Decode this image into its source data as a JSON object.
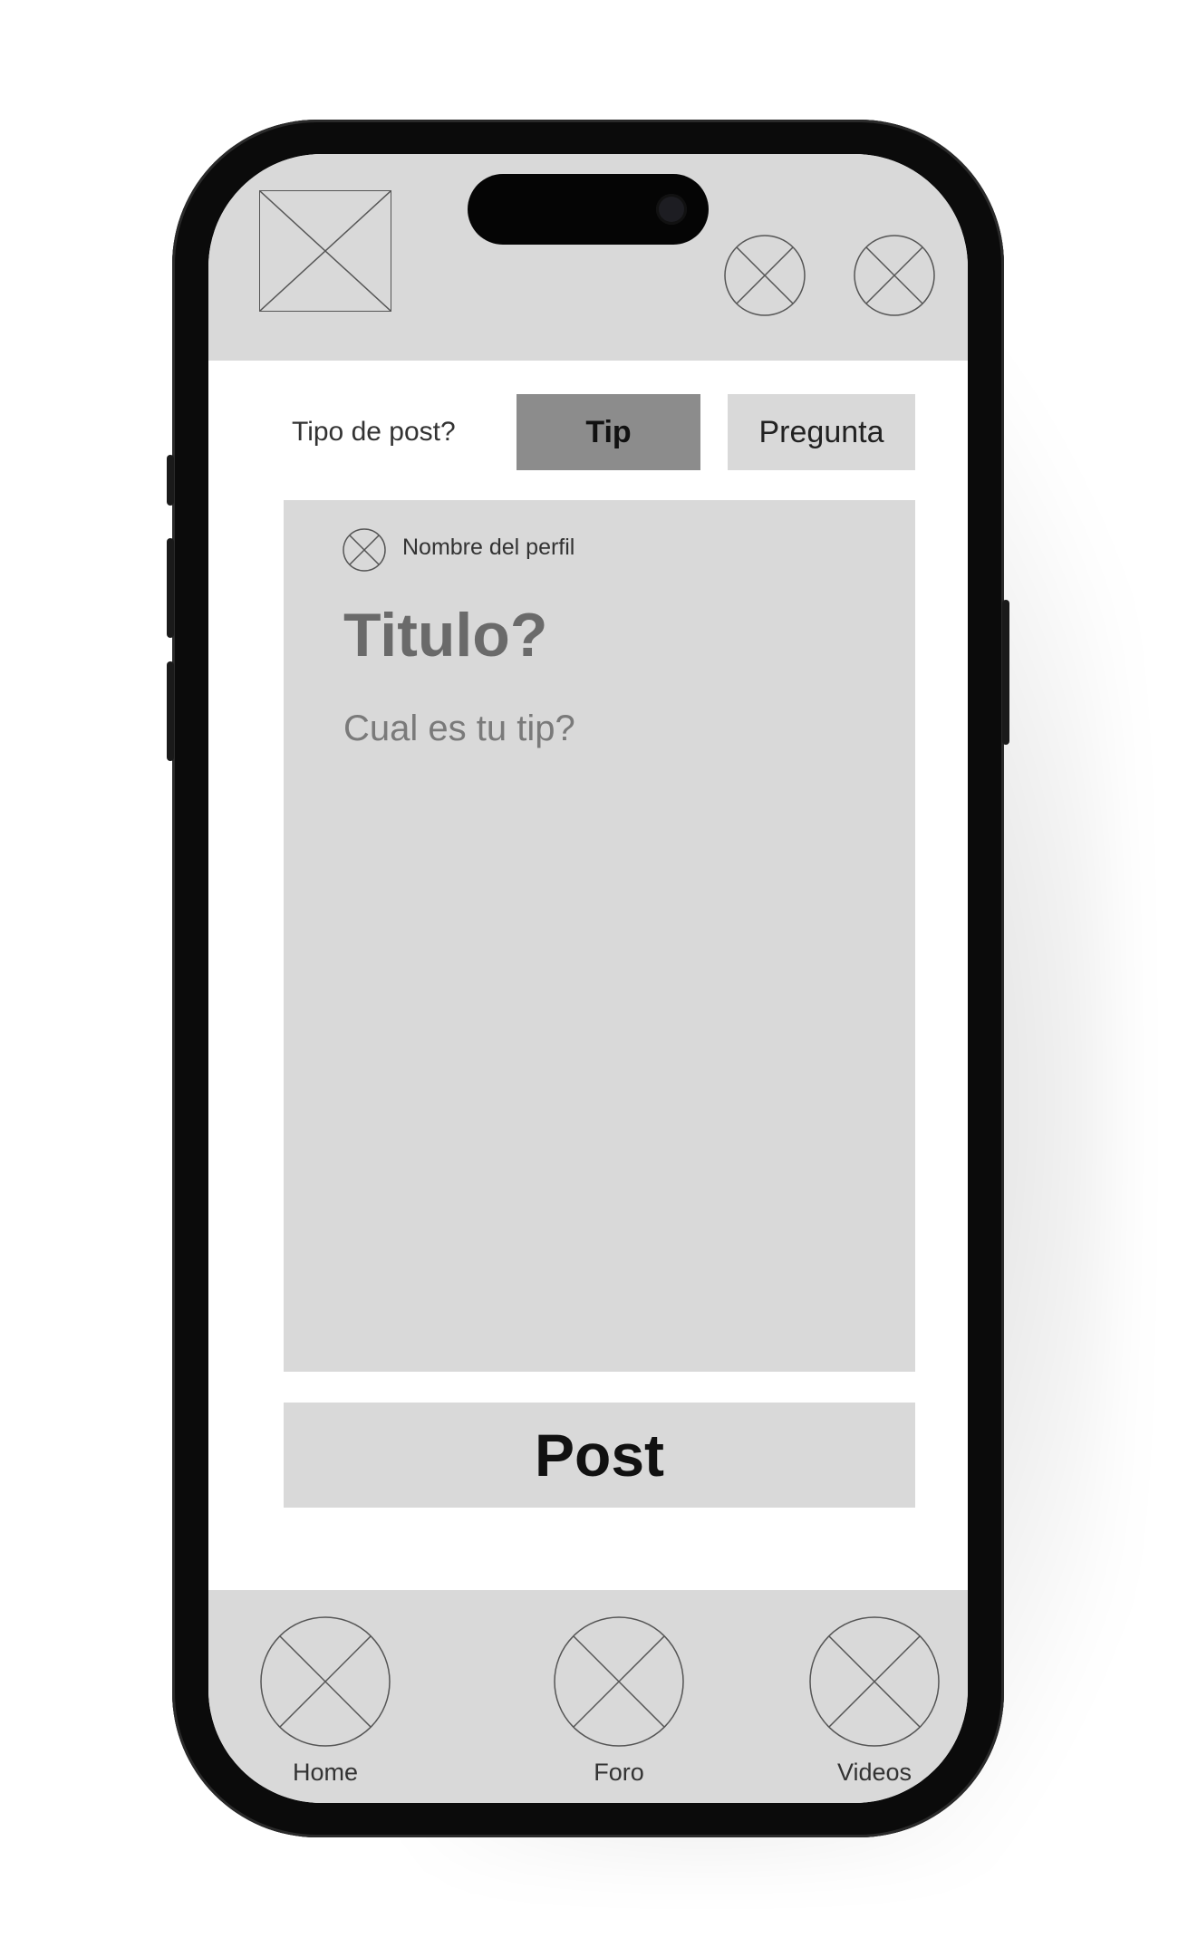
{
  "post_type": {
    "label": "Tipo de post?",
    "options": [
      {
        "label": "Tip",
        "selected": true
      },
      {
        "label": "Pregunta",
        "selected": false
      }
    ]
  },
  "card": {
    "profile_name": "Nombre del perfil",
    "title_placeholder": "Titulo?",
    "body_placeholder": "Cual es tu tip?"
  },
  "post_button": {
    "label": "Post"
  },
  "bottom_nav": [
    {
      "label": "Home",
      "icon": "home-placeholder-icon"
    },
    {
      "label": "Foro",
      "icon": "foro-placeholder-icon"
    },
    {
      "label": "Videos",
      "icon": "videos-placeholder-icon"
    }
  ],
  "colors": {
    "panel_gray": "#d9d9d9",
    "selected_gray": "#8c8c8c",
    "frame_black": "#0b0b0b"
  }
}
